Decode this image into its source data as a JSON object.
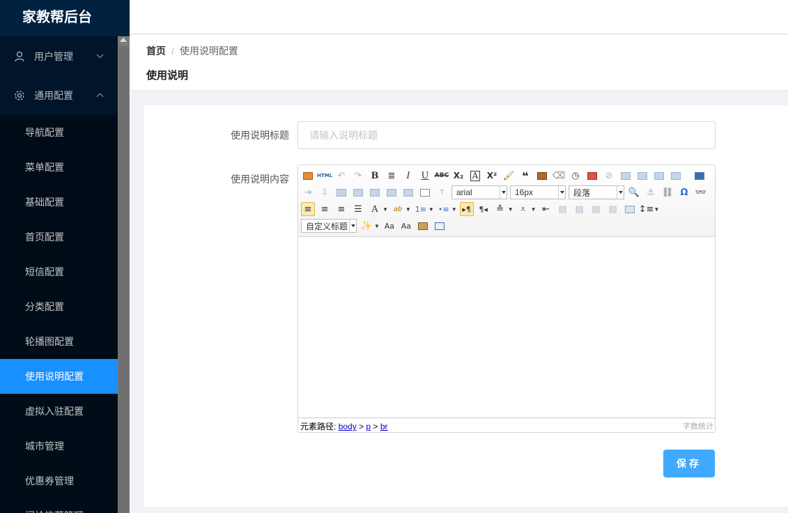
{
  "app": {
    "title": "家教帮后台"
  },
  "sidebar": {
    "groups": [
      {
        "label": "用户管理",
        "icon": "user-icon",
        "expanded": false
      },
      {
        "label": "通用配置",
        "icon": "gear-icon",
        "expanded": true
      }
    ],
    "items": [
      {
        "label": "导航配置"
      },
      {
        "label": "菜单配置"
      },
      {
        "label": "基础配置"
      },
      {
        "label": "首页配置"
      },
      {
        "label": "短信配置"
      },
      {
        "label": "分类配置"
      },
      {
        "label": "轮播图配置"
      },
      {
        "label": "使用说明配置",
        "active": true
      },
      {
        "label": "虚拟入驻配置"
      },
      {
        "label": "城市管理"
      },
      {
        "label": "优惠券管理"
      },
      {
        "label": "问诊推荐管理"
      }
    ]
  },
  "breadcrumb": {
    "home": "首页",
    "separator": "/",
    "current": "使用说明配置"
  },
  "page": {
    "title": "使用说明"
  },
  "form": {
    "title_label": "使用说明标题",
    "title_placeholder": "请输入说明标题",
    "title_value": "",
    "content_label": "使用说明内容",
    "save_label": "保存"
  },
  "editor": {
    "font_family": "arial",
    "font_size": "16px",
    "paragraph": "段落",
    "custom_heading": "自定义标题",
    "html_label": "HTML",
    "status_prefix": "元素路径:",
    "path": [
      "body",
      "p",
      "br"
    ],
    "path_sep": ">",
    "word_count_label": "字数统计"
  },
  "colors": {
    "sidebar_bg": "#001529",
    "active": "#1890ff",
    "save_button": "#40a9ff"
  }
}
